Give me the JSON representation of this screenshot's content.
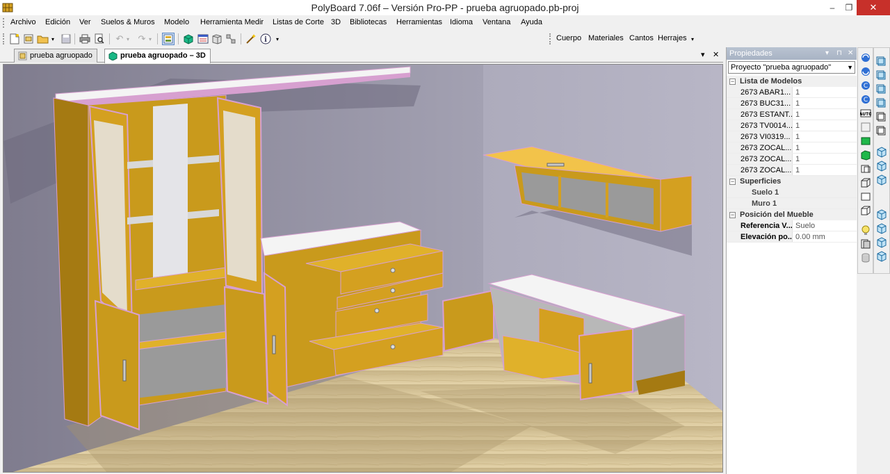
{
  "window": {
    "title": "PolyBoard 7.06f – Versión Pro-PP - prueba agruopado.pb-proj",
    "minimize": "–",
    "maximize": "❐",
    "close": "✕"
  },
  "menu": [
    {
      "label": "Archivo"
    },
    {
      "label": "Edición"
    },
    {
      "label": "Ver"
    },
    {
      "label": "Suelos & Muros"
    },
    {
      "label": "Modelo"
    },
    {
      "label": "Herramienta Medir"
    },
    {
      "label": "Listas de Corte"
    },
    {
      "label": "3D"
    },
    {
      "label": "Bibliotecas"
    },
    {
      "label": "Herramientas"
    },
    {
      "label": "Idioma"
    },
    {
      "label": "Ventana"
    },
    {
      "label": "Ayuda"
    }
  ],
  "toolbar_right": {
    "cuerpo": "Cuerpo",
    "materiales": "Materiales",
    "cantos": "Cantos",
    "herrajes": "Herrajes"
  },
  "tabs": [
    {
      "label": "prueba agruopado"
    },
    {
      "label": "prueba agruopado – 3D"
    }
  ],
  "tab_controls": {
    "dropdown": "▾",
    "close": "✕"
  },
  "panel": {
    "title": "Propiedades",
    "controls": [
      "▾",
      "⊓",
      "✕"
    ],
    "project_select": "Proyecto \"prueba agruopado\"",
    "sections": {
      "models": "Lista de Modelos",
      "surfaces": "Superficies",
      "position": "Posición del Mueble"
    },
    "models": [
      {
        "name": "2673 ABAR1...",
        "qty": "1"
      },
      {
        "name": "2673 BUC31...",
        "qty": "1"
      },
      {
        "name": "2673 ESTANT...",
        "qty": "1"
      },
      {
        "name": "2673 TV0014...",
        "qty": "1"
      },
      {
        "name": "2673 VI0319...",
        "qty": "1"
      },
      {
        "name": "2673 ZOCAL...",
        "qty": "1"
      },
      {
        "name": "2673 ZOCAL...",
        "qty": "1"
      },
      {
        "name": "2673 ZOCAL...",
        "qty": "1"
      }
    ],
    "surfaces": [
      "Suelo 1",
      "Muro 1"
    ],
    "position": [
      {
        "name": "Referencia V...",
        "value": "Suelo"
      },
      {
        "name": "Elevación po...",
        "value": "0.00 mm"
      }
    ]
  },
  "colors": {
    "wood": "#d4a020",
    "wood_dark": "#a57a12",
    "edge_pink": "#d7a0d0",
    "top_white": "#f4f4f4",
    "wall": "#a9a7b8",
    "floor": "#d8c597",
    "titlebar_close": "#c7302a"
  }
}
